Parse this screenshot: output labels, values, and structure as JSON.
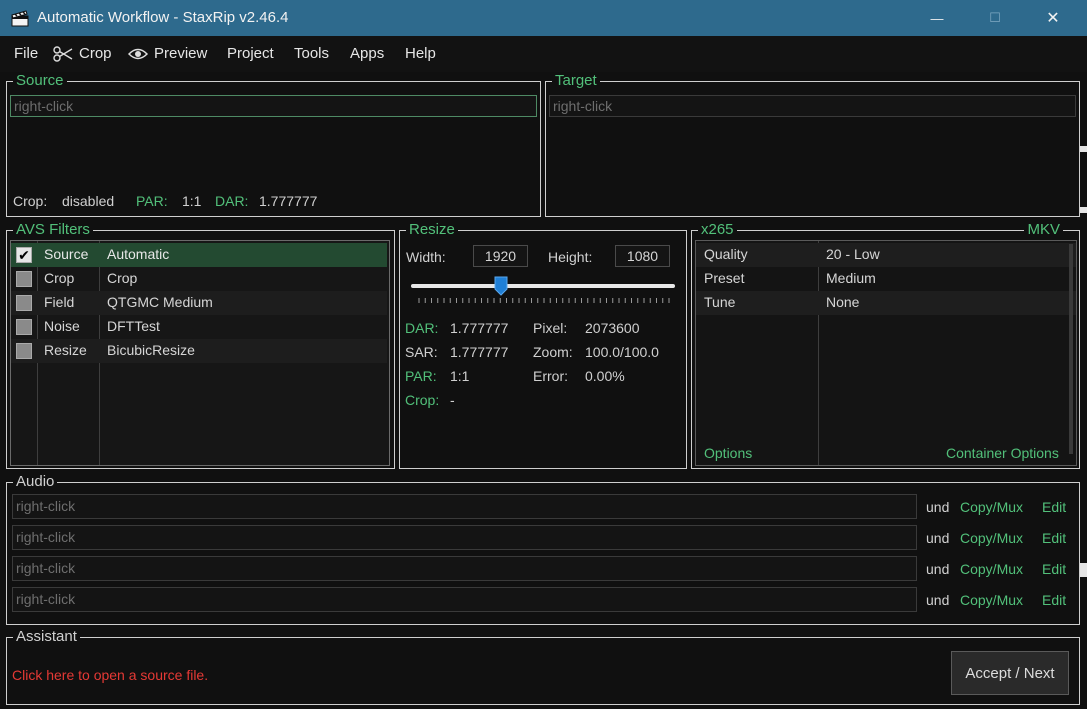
{
  "window": {
    "title": "Automatic Workflow - StaxRip v2.46.4",
    "minimize_glyph": "—",
    "maximize_glyph": "☐",
    "close_glyph": "✕"
  },
  "menu": [
    {
      "label": "File",
      "icon": null
    },
    {
      "label": "Crop",
      "icon": "scissors-icon"
    },
    {
      "label": "Preview",
      "icon": "eye-icon"
    },
    {
      "label": "Project",
      "icon": null
    },
    {
      "label": "Tools",
      "icon": null
    },
    {
      "label": "Apps",
      "icon": null
    },
    {
      "label": "Help",
      "icon": null
    }
  ],
  "source": {
    "label": "Source",
    "placeholder": "right-click",
    "crop_label": "Crop:",
    "crop_value": "disabled",
    "par_label": "PAR:",
    "par_value": "1:1",
    "dar_label": "DAR:",
    "dar_value": "1.777777"
  },
  "target": {
    "label": "Target",
    "placeholder": "right-click"
  },
  "avs_filters": {
    "label": "AVS Filters",
    "rows": [
      {
        "checked": true,
        "category": "Source",
        "name": "Automatic",
        "checkmark": "✔"
      },
      {
        "checked": false,
        "category": "Crop",
        "name": "Crop"
      },
      {
        "checked": false,
        "category": "Field",
        "name": "QTGMC Medium"
      },
      {
        "checked": false,
        "category": "Noise",
        "name": "DFTTest"
      },
      {
        "checked": false,
        "category": "Resize",
        "name": "BicubicResize"
      }
    ]
  },
  "resize": {
    "label": "Resize",
    "width_label": "Width:",
    "width_value": "1920",
    "height_label": "Height:",
    "height_value": "1080",
    "slider_fraction": 0.34,
    "dar_label": "DAR:",
    "dar_value": "1.777777",
    "sar_label": "SAR:",
    "sar_value": "1.777777",
    "par_label": "PAR:",
    "par_value": "1:1",
    "crop_label": "Crop:",
    "crop_value": "-",
    "pixel_label": "Pixel:",
    "pixel_value": "2073600",
    "zoom_label": "Zoom:",
    "zoom_value": "100.0/100.0",
    "error_label": "Error:",
    "error_value": "0.00%"
  },
  "encoder": {
    "label": "x265",
    "container_label": "MKV",
    "rows": [
      {
        "key": "Quality",
        "value": "20 - Low"
      },
      {
        "key": "Preset",
        "value": "Medium"
      },
      {
        "key": "Tune",
        "value": "None"
      }
    ],
    "options_link": "Options",
    "container_options_link": "Container Options"
  },
  "audio": {
    "label": "Audio",
    "tracks": [
      {
        "placeholder": "right-click",
        "lang": "und",
        "codec": "Copy/Mux",
        "edit": "Edit"
      },
      {
        "placeholder": "right-click",
        "lang": "und",
        "codec": "Copy/Mux",
        "edit": "Edit"
      },
      {
        "placeholder": "right-click",
        "lang": "und",
        "codec": "Copy/Mux",
        "edit": "Edit"
      },
      {
        "placeholder": "right-click",
        "lang": "und",
        "codec": "Copy/Mux",
        "edit": "Edit"
      }
    ]
  },
  "assistant": {
    "label": "Assistant",
    "message": "Click here to open a source file.",
    "accept_button": "Accept / Next"
  },
  "colors": {
    "titlebar": "#2e6a8d",
    "accent_green": "#52c07a",
    "warning_red": "#e53935",
    "slider_thumb": "#1f7fd6",
    "selection": "#234a31"
  }
}
